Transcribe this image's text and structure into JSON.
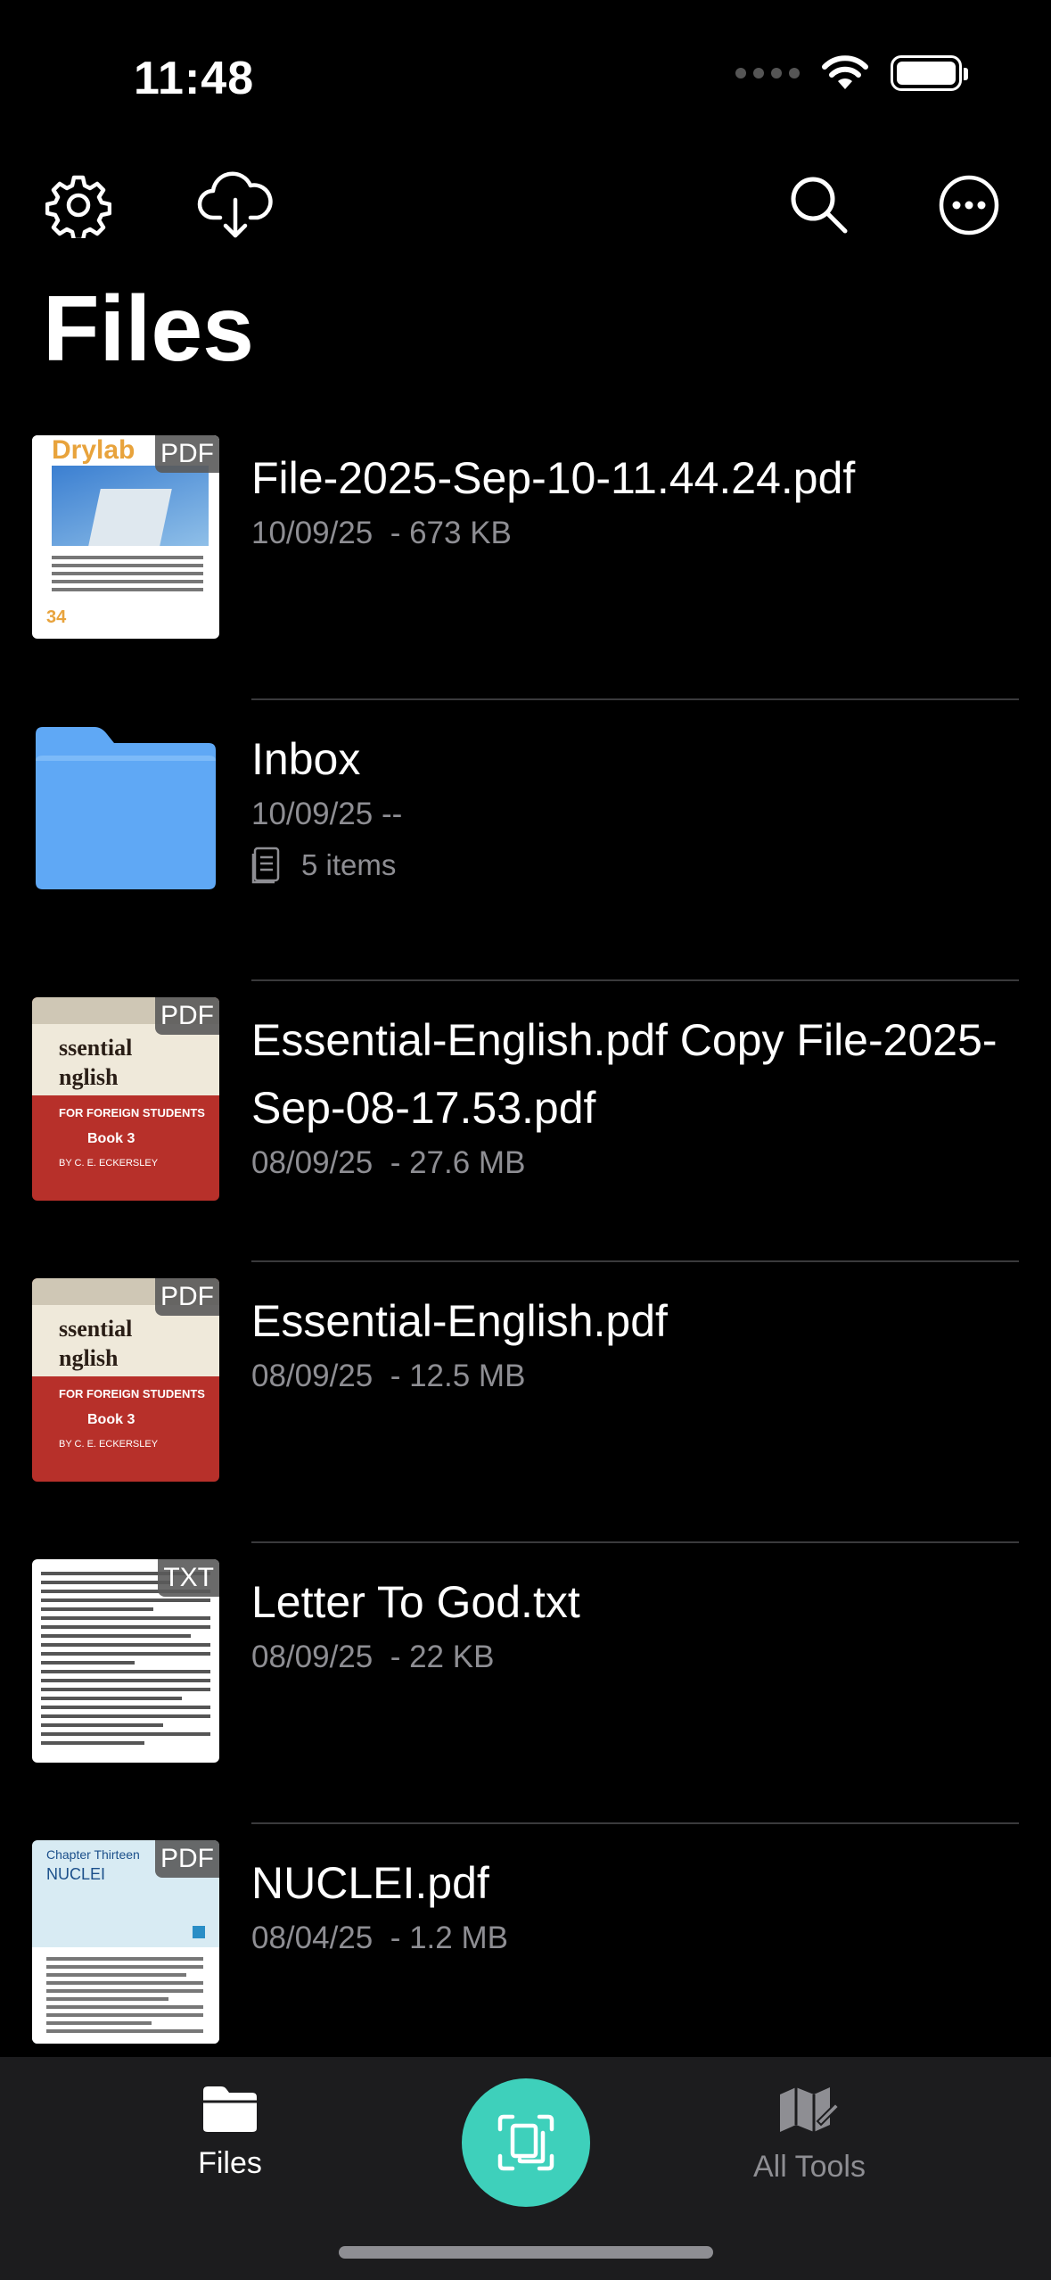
{
  "status_bar": {
    "time": "11:48"
  },
  "header": {
    "title": "Files"
  },
  "files": [
    {
      "name": "File-2025-Sep-10-11.44.24.pdf",
      "date": "10/09/25",
      "size": "673 KB",
      "badge": "PDF"
    },
    {
      "name": "Inbox",
      "date": "10/09/25",
      "size": "--",
      "items": "5 items"
    },
    {
      "name": "Essential-English.pdf Copy File-2025-Sep-08-17.53.pdf",
      "date": "08/09/25",
      "size": "27.6 MB",
      "badge": "PDF"
    },
    {
      "name": "Essential-English.pdf",
      "date": "08/09/25",
      "size": "12.5 MB",
      "badge": "PDF"
    },
    {
      "name": "Letter To God.txt",
      "date": "08/09/25",
      "size": "22 KB",
      "badge": "TXT"
    },
    {
      "name": "NUCLEI.pdf",
      "date": "08/04/25",
      "size": "1.2 MB",
      "badge": "PDF"
    }
  ],
  "thumbnails": {
    "drylab_title": "Drylab",
    "drylab_page": "34",
    "english_line1": "ssential",
    "english_line2": "nglish",
    "english_sub": "FOR FOREIGN STUDENTS",
    "english_book": "Book 3",
    "english_author": "BY C. E. ECKERSLEY",
    "nuclei_chapter": "Chapter Thirteen",
    "nuclei_title": "NUCLEI"
  },
  "tab_bar": {
    "files_label": "Files",
    "tools_label": "All Tools"
  },
  "colors": {
    "accent": "#3ed0bb",
    "folder": "#5fa8f5",
    "secondary_text": "#8e8e93",
    "divider": "#3a3a3c"
  }
}
